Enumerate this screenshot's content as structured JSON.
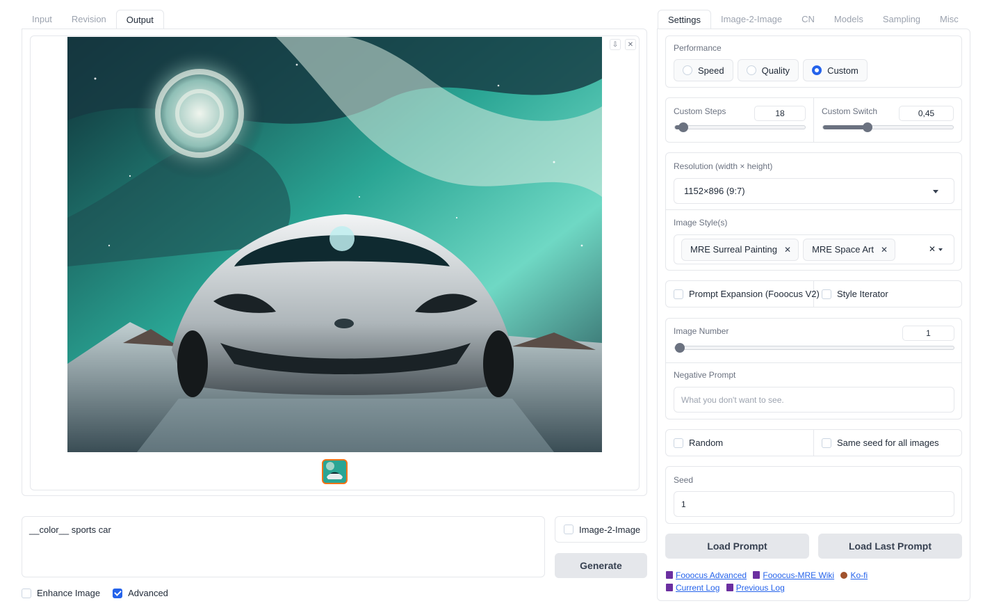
{
  "left_tabs": [
    "Input",
    "Revision",
    "Output"
  ],
  "active_left_tab": "Output",
  "gallery": {
    "download_icon": "download-icon",
    "close_icon": "close-icon"
  },
  "prompt": {
    "value": "__color__ sports car"
  },
  "image2image_checkbox": {
    "label": "Image-2-Image",
    "checked": false
  },
  "generate_label": "Generate",
  "enhance_image": {
    "label": "Enhance Image",
    "checked": false
  },
  "advanced": {
    "label": "Advanced",
    "checked": true
  },
  "right_tabs": [
    "Settings",
    "Image-2-Image",
    "CN",
    "Models",
    "Sampling",
    "Misc"
  ],
  "active_right_tab": "Settings",
  "performance": {
    "label": "Performance",
    "options": [
      "Speed",
      "Quality",
      "Custom"
    ],
    "selected": "Custom"
  },
  "custom_steps": {
    "label": "Custom Steps",
    "value": "18",
    "fraction": 0.03
  },
  "custom_switch": {
    "label": "Custom Switch",
    "value": "0,45",
    "fraction": 0.33
  },
  "resolution": {
    "label": "Resolution (width × height)",
    "value": "1152×896 (9:7)"
  },
  "image_styles": {
    "label": "Image Style(s)",
    "chips": [
      "MRE Surreal Painting",
      "MRE Space Art"
    ]
  },
  "prompt_expansion": {
    "label": "Prompt Expansion (Fooocus V2)",
    "checked": false
  },
  "style_iterator": {
    "label": "Style Iterator",
    "checked": false
  },
  "image_number": {
    "label": "Image Number",
    "value": "1",
    "fraction": 0.0
  },
  "negative_prompt": {
    "label": "Negative Prompt",
    "placeholder": "What you don't want to see."
  },
  "random": {
    "label": "Random",
    "checked": false
  },
  "same_seed": {
    "label": "Same seed for all images",
    "checked": false
  },
  "seed": {
    "label": "Seed",
    "value": "1"
  },
  "load_prompt_label": "Load Prompt",
  "load_last_prompt_label": "Load Last Prompt",
  "links": {
    "fooocus_advanced": "Fooocus Advanced",
    "fooocus_mre_wiki": "Fooocus-MRE Wiki",
    "ko_fi": "Ko-fi",
    "current_log": "Current Log",
    "previous_log": "Previous Log"
  },
  "colors": {
    "accent": "#2563eb",
    "thumb_border": "#f97316"
  }
}
